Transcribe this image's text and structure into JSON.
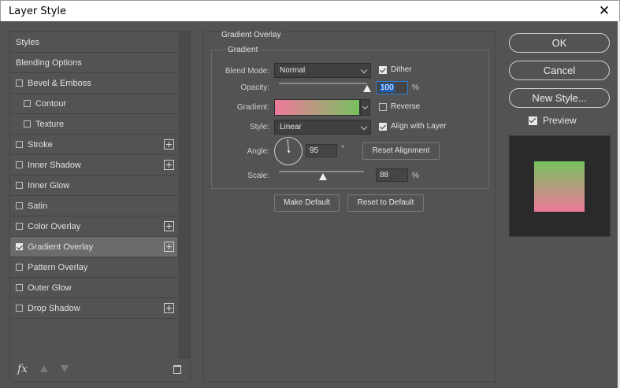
{
  "window": {
    "title": "Layer Style",
    "close_glyph": "✕"
  },
  "sidebar": {
    "items": [
      {
        "label": "Styles",
        "checkbox": false,
        "checked": false,
        "indent": false,
        "plus": false,
        "selected": false
      },
      {
        "label": "Blending Options",
        "checkbox": false,
        "checked": false,
        "indent": false,
        "plus": false,
        "selected": false
      },
      {
        "label": "Bevel & Emboss",
        "checkbox": true,
        "checked": false,
        "indent": false,
        "plus": false,
        "selected": false
      },
      {
        "label": "Contour",
        "checkbox": true,
        "checked": false,
        "indent": true,
        "plus": false,
        "selected": false
      },
      {
        "label": "Texture",
        "checkbox": true,
        "checked": false,
        "indent": true,
        "plus": false,
        "selected": false
      },
      {
        "label": "Stroke",
        "checkbox": true,
        "checked": false,
        "indent": false,
        "plus": true,
        "selected": false
      },
      {
        "label": "Inner Shadow",
        "checkbox": true,
        "checked": false,
        "indent": false,
        "plus": true,
        "selected": false
      },
      {
        "label": "Inner Glow",
        "checkbox": true,
        "checked": false,
        "indent": false,
        "plus": false,
        "selected": false
      },
      {
        "label": "Satin",
        "checkbox": true,
        "checked": false,
        "indent": false,
        "plus": false,
        "selected": false
      },
      {
        "label": "Color Overlay",
        "checkbox": true,
        "checked": false,
        "indent": false,
        "plus": true,
        "selected": false
      },
      {
        "label": "Gradient Overlay",
        "checkbox": true,
        "checked": true,
        "indent": false,
        "plus": true,
        "selected": true
      },
      {
        "label": "Pattern Overlay",
        "checkbox": true,
        "checked": false,
        "indent": false,
        "plus": false,
        "selected": false
      },
      {
        "label": "Outer Glow",
        "checkbox": true,
        "checked": false,
        "indent": false,
        "plus": false,
        "selected": false
      },
      {
        "label": "Drop Shadow",
        "checkbox": true,
        "checked": false,
        "indent": false,
        "plus": true,
        "selected": false
      }
    ],
    "footer": {
      "fx_label": "fx"
    }
  },
  "panel": {
    "section_title": "Gradient Overlay",
    "group_title": "Gradient",
    "blend_mode": {
      "label": "Blend Mode:",
      "value": "Normal"
    },
    "dither": {
      "label": "Dither",
      "checked": true
    },
    "opacity": {
      "label": "Opacity:",
      "value": "100",
      "unit": "%",
      "level": 1.0
    },
    "gradient": {
      "label": "Gradient:",
      "start_color": "#f0799b",
      "end_color": "#76c15f"
    },
    "reverse": {
      "label": "Reverse",
      "checked": false
    },
    "style": {
      "label": "Style:",
      "value": "Linear"
    },
    "align_with_layer": {
      "label": "Align with Layer",
      "checked": true
    },
    "angle": {
      "label": "Angle:",
      "value": "95",
      "unit": "°"
    },
    "reset_alignment_label": "Reset Alignment",
    "scale": {
      "label": "Scale:",
      "value": "88",
      "unit": "%"
    },
    "make_default_label": "Make Default",
    "reset_to_default_label": "Reset to Default"
  },
  "actions": {
    "ok_label": "OK",
    "cancel_label": "Cancel",
    "new_style_label": "New Style...",
    "preview": {
      "label": "Preview",
      "checked": true
    }
  },
  "colors": {
    "dialog_bg": "#535353",
    "selection": "#6b6b6b",
    "accent": "#1e5fb8"
  }
}
